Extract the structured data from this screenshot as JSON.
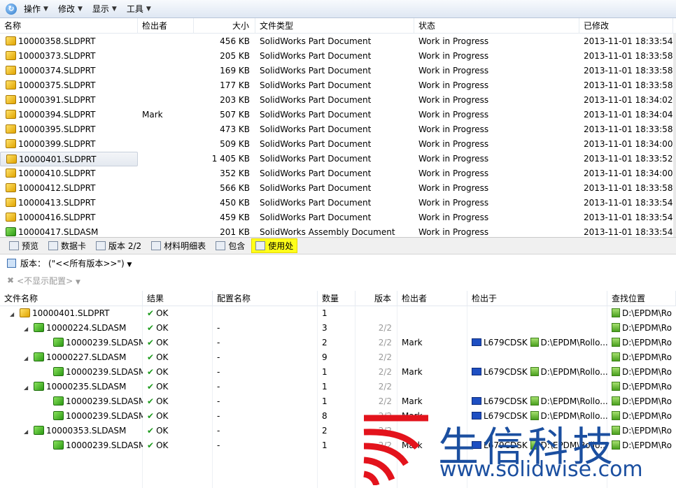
{
  "toolbar": {
    "items": [
      {
        "label": "操作"
      },
      {
        "label": "修改"
      },
      {
        "label": "显示"
      },
      {
        "label": "工具"
      }
    ]
  },
  "file_list": {
    "columns": [
      "名称",
      "检出者",
      "大小",
      "文件类型",
      "状态",
      "已修改"
    ],
    "rows": [
      {
        "name": "10000358.SLDPRT",
        "checked_out_by": "",
        "size": "456 KB",
        "type": "SolidWorks Part Document",
        "state": "Work in Progress",
        "modified": "2013-11-01 18:33:54",
        "icon": "part-icon"
      },
      {
        "name": "10000373.SLDPRT",
        "checked_out_by": "",
        "size": "205 KB",
        "type": "SolidWorks Part Document",
        "state": "Work in Progress",
        "modified": "2013-11-01 18:33:58",
        "icon": "part-icon"
      },
      {
        "name": "10000374.SLDPRT",
        "checked_out_by": "",
        "size": "169 KB",
        "type": "SolidWorks Part Document",
        "state": "Work in Progress",
        "modified": "2013-11-01 18:33:58",
        "icon": "part-icon"
      },
      {
        "name": "10000375.SLDPRT",
        "checked_out_by": "",
        "size": "177 KB",
        "type": "SolidWorks Part Document",
        "state": "Work in Progress",
        "modified": "2013-11-01 18:33:58",
        "icon": "part-icon"
      },
      {
        "name": "10000391.SLDPRT",
        "checked_out_by": "",
        "size": "203 KB",
        "type": "SolidWorks Part Document",
        "state": "Work in Progress",
        "modified": "2013-11-01 18:34:02",
        "icon": "part-icon"
      },
      {
        "name": "10000394.SLDPRT",
        "checked_out_by": "Mark",
        "size": "507 KB",
        "type": "SolidWorks Part Document",
        "state": "Work in Progress",
        "modified": "2013-11-01 18:34:04",
        "icon": "part-icon"
      },
      {
        "name": "10000395.SLDPRT",
        "checked_out_by": "",
        "size": "473 KB",
        "type": "SolidWorks Part Document",
        "state": "Work in Progress",
        "modified": "2013-11-01 18:33:58",
        "icon": "part-icon"
      },
      {
        "name": "10000399.SLDPRT",
        "checked_out_by": "",
        "size": "509 KB",
        "type": "SolidWorks Part Document",
        "state": "Work in Progress",
        "modified": "2013-11-01 18:34:00",
        "icon": "part-icon"
      },
      {
        "name": "10000401.SLDPRT",
        "checked_out_by": "",
        "size": "1 405 KB",
        "type": "SolidWorks Part Document",
        "state": "Work in Progress",
        "modified": "2013-11-01 18:33:52",
        "icon": "part-icon",
        "selected": true
      },
      {
        "name": "10000410.SLDPRT",
        "checked_out_by": "",
        "size": "352 KB",
        "type": "SolidWorks Part Document",
        "state": "Work in Progress",
        "modified": "2013-11-01 18:34:00",
        "icon": "part-icon"
      },
      {
        "name": "10000412.SLDPRT",
        "checked_out_by": "",
        "size": "566 KB",
        "type": "SolidWorks Part Document",
        "state": "Work in Progress",
        "modified": "2013-11-01 18:33:58",
        "icon": "part-icon"
      },
      {
        "name": "10000413.SLDPRT",
        "checked_out_by": "",
        "size": "450 KB",
        "type": "SolidWorks Part Document",
        "state": "Work in Progress",
        "modified": "2013-11-01 18:33:54",
        "icon": "part-icon"
      },
      {
        "name": "10000416.SLDPRT",
        "checked_out_by": "",
        "size": "459 KB",
        "type": "SolidWorks Part Document",
        "state": "Work in Progress",
        "modified": "2013-11-01 18:33:54",
        "icon": "part-icon"
      },
      {
        "name": "10000417.SLDASM",
        "checked_out_by": "",
        "size": "201 KB",
        "type": "SolidWorks Assembly Document",
        "state": "Work in Progress",
        "modified": "2013-11-01 18:33:54",
        "icon": "asm-icon"
      }
    ]
  },
  "tabs": [
    {
      "label": "预览",
      "icon": "preview-icon"
    },
    {
      "label": "数据卡",
      "icon": "datacard-icon"
    },
    {
      "label": "版本 2/2",
      "icon": "version-icon"
    },
    {
      "label": "材料明细表",
      "icon": "bom-icon"
    },
    {
      "label": "包含",
      "icon": "contains-icon"
    },
    {
      "label": "使用处",
      "icon": "where-used-icon",
      "active": true
    }
  ],
  "version_bar": {
    "label": "版本：",
    "value": "(\"<<所有版本>>\")"
  },
  "config_bar": {
    "label": "<不显示配置>"
  },
  "tree": {
    "columns": [
      "文件名称",
      "结果",
      "配置名称",
      "数量",
      "版本",
      "检出者",
      "检出于",
      "查找位置"
    ],
    "rows": [
      {
        "indent": 0,
        "expander": "◢",
        "name": "10000401.SLDPRT",
        "icon": "part-icon",
        "result": "OK",
        "config": "",
        "qty": "1",
        "version": "",
        "checked_out_by": "",
        "computer": "",
        "checkout_path": "",
        "location": "D:\\EPDM\\Ro"
      },
      {
        "indent": 1,
        "expander": "◢",
        "name": "10000224.SLDASM",
        "icon": "asm-icon",
        "result": "OK",
        "config": "-",
        "qty": "3",
        "version": "2/2",
        "checked_out_by": "",
        "computer": "",
        "checkout_path": "",
        "location": "D:\\EPDM\\Ro"
      },
      {
        "indent": 2,
        "expander": "",
        "name": "10000239.SLDASM",
        "icon": "asm-icon",
        "result": "OK",
        "config": "-",
        "qty": "2",
        "version": "2/2",
        "checked_out_by": "Mark",
        "computer": "L679CDSK",
        "checkout_path": "D:\\EPDM\\Rollo...",
        "location": "D:\\EPDM\\Ro"
      },
      {
        "indent": 1,
        "expander": "◢",
        "name": "10000227.SLDASM",
        "icon": "asm-icon",
        "result": "OK",
        "config": "-",
        "qty": "9",
        "version": "2/2",
        "checked_out_by": "",
        "computer": "",
        "checkout_path": "",
        "location": "D:\\EPDM\\Ro"
      },
      {
        "indent": 2,
        "expander": "",
        "name": "10000239.SLDASM",
        "icon": "asm-icon",
        "result": "OK",
        "config": "-",
        "qty": "1",
        "version": "2/2",
        "checked_out_by": "Mark",
        "computer": "L679CDSK",
        "checkout_path": "D:\\EPDM\\Rollo...",
        "location": "D:\\EPDM\\Ro"
      },
      {
        "indent": 1,
        "expander": "◢",
        "name": "10000235.SLDASM",
        "icon": "asm-icon",
        "result": "OK",
        "config": "-",
        "qty": "1",
        "version": "2/2",
        "checked_out_by": "",
        "computer": "",
        "checkout_path": "",
        "location": "D:\\EPDM\\Ro"
      },
      {
        "indent": 2,
        "expander": "",
        "name": "10000239.SLDASM",
        "icon": "asm-icon",
        "result": "OK",
        "config": "-",
        "qty": "1",
        "version": "2/2",
        "checked_out_by": "Mark",
        "computer": "L679CDSK",
        "checkout_path": "D:\\EPDM\\Rollo...",
        "location": "D:\\EPDM\\Ro"
      },
      {
        "indent": 2,
        "expander": "",
        "name": "10000239.SLDASM",
        "icon": "asm-icon",
        "result": "OK",
        "config": "-",
        "qty": "8",
        "version": "2/2",
        "checked_out_by": "Mark",
        "computer": "L679CDSK",
        "checkout_path": "D:\\EPDM\\Rollo...",
        "location": "D:\\EPDM\\Ro"
      },
      {
        "indent": 1,
        "expander": "◢",
        "name": "10000353.SLDASM",
        "icon": "asm-icon",
        "result": "OK",
        "config": "-",
        "qty": "2",
        "version": "2/2",
        "checked_out_by": "",
        "computer": "",
        "checkout_path": "",
        "location": "D:\\EPDM\\Ro"
      },
      {
        "indent": 2,
        "expander": "",
        "name": "10000239.SLDASM",
        "icon": "asm-icon",
        "result": "OK",
        "config": "-",
        "qty": "1",
        "version": "2/2",
        "checked_out_by": "Mark",
        "computer": "L679CDSK",
        "checkout_path": "D:\\EPDM\\Rollo...",
        "location": "D:\\EPDM\\Ro"
      }
    ]
  },
  "watermark": {
    "title": "生信科技",
    "url": "www.solidwise.com"
  }
}
